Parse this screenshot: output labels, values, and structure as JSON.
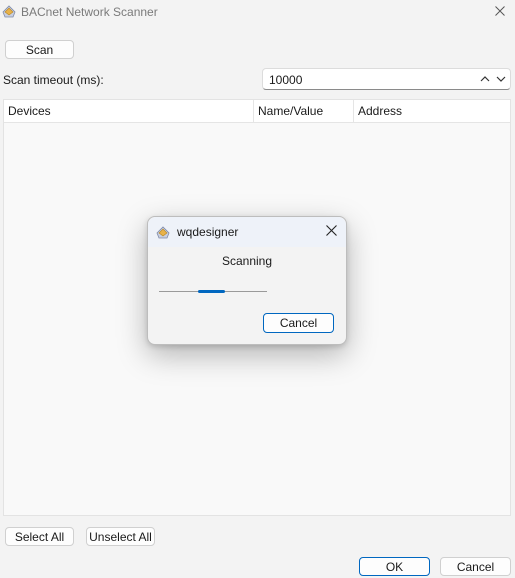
{
  "window": {
    "title": "BACnet Network Scanner",
    "icon": "app-icon",
    "close_icon": "close-icon"
  },
  "toolbar": {
    "scan_label": "Scan"
  },
  "timeout": {
    "label": "Scan timeout (ms):",
    "value": "10000"
  },
  "table": {
    "columns": [
      "Devices",
      "Name/Value",
      "Address"
    ],
    "rows": []
  },
  "footer": {
    "select_all_label": "Select All",
    "unselect_all_label": "Unselect All",
    "ok_label": "OK",
    "cancel_label": "Cancel"
  },
  "dialog": {
    "title": "wqdesigner",
    "message": "Scanning",
    "cancel_label": "Cancel",
    "progress_indeterminate": true
  },
  "colors": {
    "accent": "#0067c0",
    "background": "#f3f3f3"
  }
}
